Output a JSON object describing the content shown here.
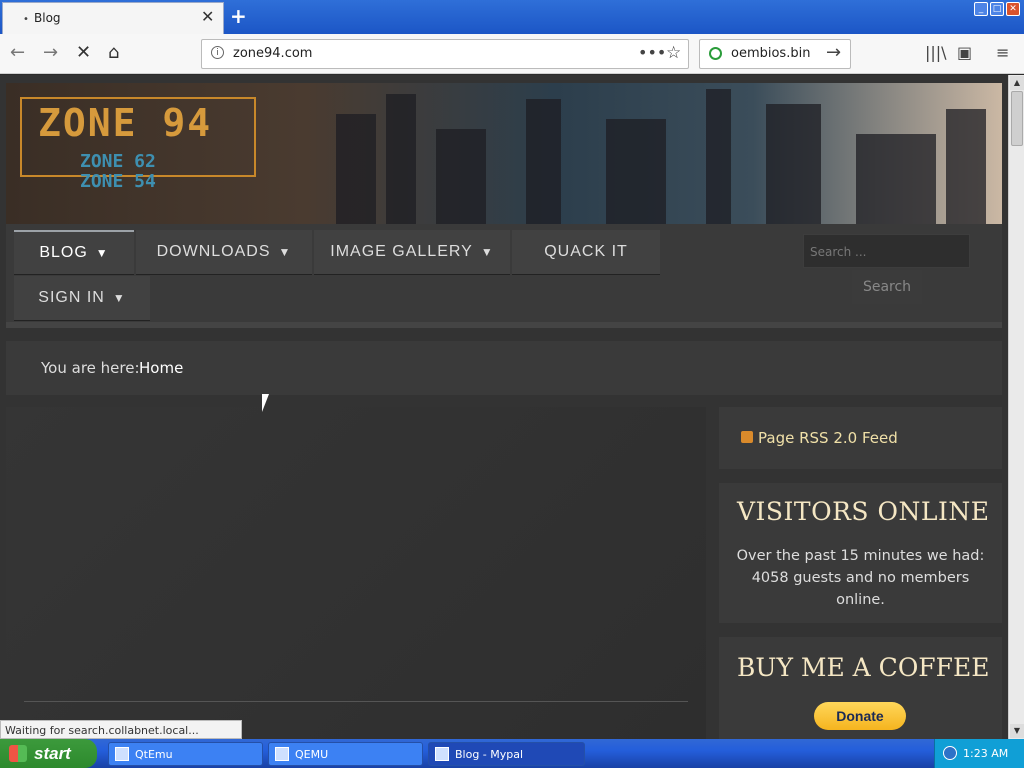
{
  "browser": {
    "tab_title": "Blog",
    "url": "zone94.com",
    "search_engine_text": "oembios.bin",
    "status_text": "Waiting for search.collabnet.local..."
  },
  "site": {
    "logo_main": "ZONE 94",
    "logo_sub1": "ZONE 62",
    "logo_sub2": "ZONE 54",
    "menu": [
      {
        "label": "BLOG"
      },
      {
        "label": "DOWNLOADS"
      },
      {
        "label": "IMAGE GALLERY"
      },
      {
        "label": "QUACK IT"
      },
      {
        "label": "SIGN IN"
      }
    ],
    "search_placeholder": "Search ...",
    "search_button": "Search",
    "breadcrumb_label": "You are here:",
    "breadcrumb_current": "Home"
  },
  "sidebar": {
    "rss_label": "Page RSS 2.0 Feed",
    "visitors_title": "VISITORS ONLINE",
    "visitors_text": "Over the past 15 minutes we had: 4058 guests and no members online.",
    "coffee_title": "BUY ME A COFFEE",
    "donate_label": "Donate"
  },
  "taskbar": {
    "start_label": "start",
    "items": [
      {
        "label": "QtEmu"
      },
      {
        "label": "QEMU"
      },
      {
        "label": "Blog - Mypal"
      }
    ],
    "clock": "1:23 AM"
  },
  "colors": {
    "accent_gold": "#f5e7c4",
    "page_bg": "#333333",
    "xp_blue": "#245edb",
    "donate_yellow": "#f5b41f"
  }
}
